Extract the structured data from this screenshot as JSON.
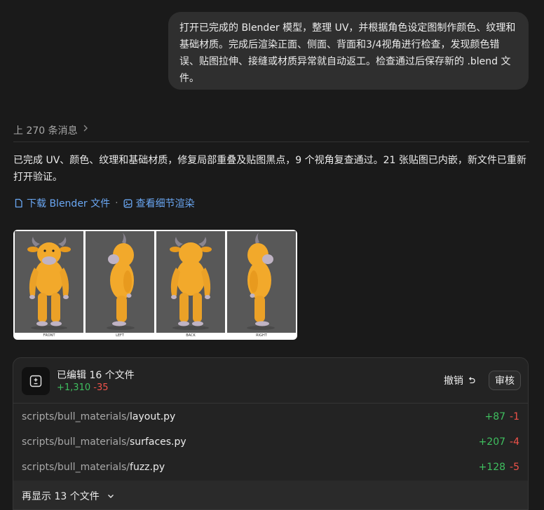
{
  "user_message": {
    "lines": [
      "打开已完成的 Blender 模型，整理 UV，并根据角色设定图制作颜色、纹理和",
      "基础材质。完成后渲染正面、侧面、背面和3/4视角进行检查，发现颜色错",
      "误、贴图拉伸、接缝或材质异常就自动返工。检查通过后保存新的 .blend 文",
      "件。"
    ]
  },
  "history": {
    "label": "上 270 条消息"
  },
  "assistant": {
    "summary_lines": [
      "已完成 UV、颜色、纹理和基础材质，修复局部重叠及贴图黑点，9 个视角复查通过。21 张贴图已内嵌，新文件已重新",
      "打开验证。"
    ],
    "download_label": "下载 Blender 文件",
    "separator": "·",
    "render_link_label": "查看细节渲染"
  },
  "renders": {
    "views": [
      {
        "label": "FRONT",
        "pose": "front"
      },
      {
        "label": "LEFT",
        "pose": "left"
      },
      {
        "label": "BACK",
        "pose": "back"
      },
      {
        "label": "RIGHT",
        "pose": "right"
      }
    ],
    "colors": {
      "body": "#f2a92b",
      "body_shade": "#d88c16",
      "muzzle": "#bfb3c4",
      "horn": "#8a8590",
      "bg": "#585858"
    }
  },
  "changes": {
    "title": "已编辑 16 个文件",
    "added": "+1,310",
    "removed": "-35",
    "undo_label": "撤销",
    "review_label": "审核",
    "files": [
      {
        "dir": "scripts/bull_materials/",
        "name": "layout.py",
        "added": "+87",
        "removed": "-1"
      },
      {
        "dir": "scripts/bull_materials/",
        "name": "surfaces.py",
        "added": "+207",
        "removed": "-4"
      },
      {
        "dir": "scripts/bull_materials/",
        "name": "fuzz.py",
        "added": "+128",
        "removed": "-5"
      }
    ],
    "show_more_label": "再显示 13 个文件"
  }
}
